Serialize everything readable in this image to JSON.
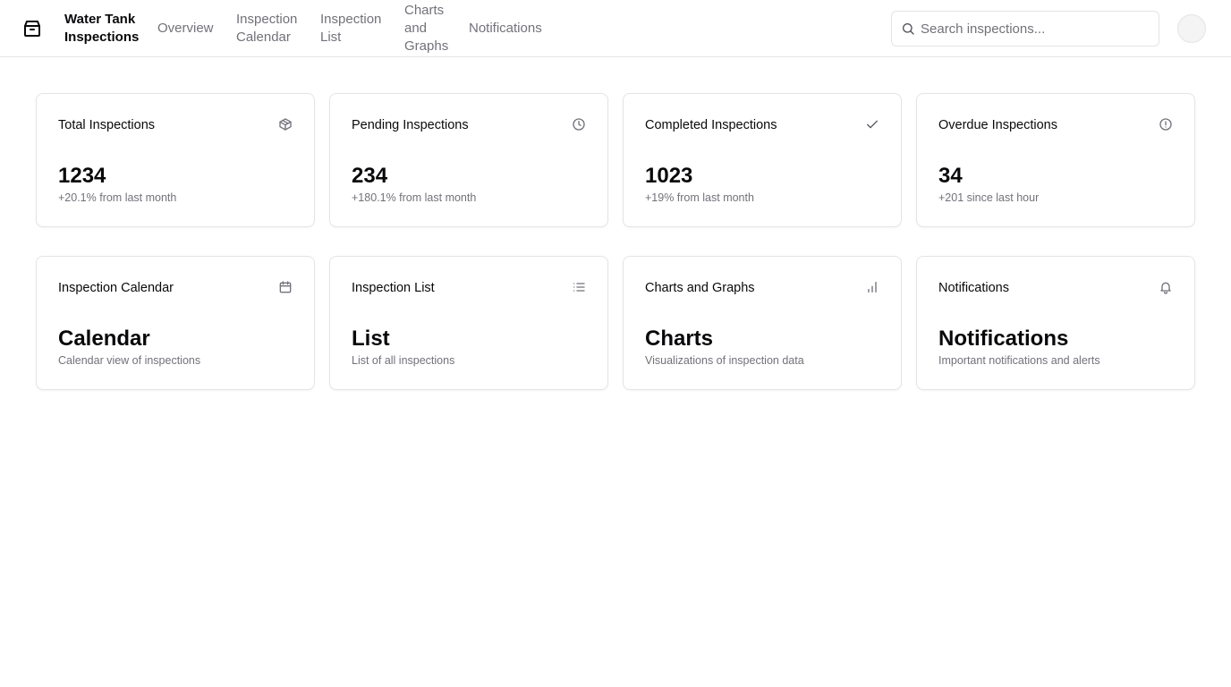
{
  "header": {
    "brand": "Water Tank Inspections",
    "logo_icon": "package-icon",
    "nav": [
      {
        "label": "Overview"
      },
      {
        "label": "Inspection Calendar"
      },
      {
        "label": "Inspection List"
      },
      {
        "label": "Charts and Graphs"
      },
      {
        "label": "Notifications"
      }
    ],
    "search": {
      "placeholder": "Search inspections...",
      "value": "",
      "icon": "search-icon"
    }
  },
  "stats": [
    {
      "title": "Total Inspections",
      "value": "1234",
      "sub": "+20.1% from last month",
      "icon": "box-icon"
    },
    {
      "title": "Pending Inspections",
      "value": "234",
      "sub": "+180.1% from last month",
      "icon": "clock-icon"
    },
    {
      "title": "Completed Inspections",
      "value": "1023",
      "sub": "+19% from last month",
      "icon": "check-icon"
    },
    {
      "title": "Overdue Inspections",
      "value": "34",
      "sub": "+201 since last hour",
      "icon": "alert-circle-icon"
    }
  ],
  "sections": [
    {
      "title": "Inspection Calendar",
      "value": "Calendar",
      "sub": "Calendar view of inspections",
      "icon": "calendar-icon"
    },
    {
      "title": "Inspection List",
      "value": "List",
      "sub": "List of all inspections",
      "icon": "list-icon"
    },
    {
      "title": "Charts and Graphs",
      "value": "Charts",
      "sub": "Visualizations of inspection data",
      "icon": "bar-chart-icon"
    },
    {
      "title": "Notifications",
      "value": "Notifications",
      "sub": "Important notifications and alerts",
      "icon": "bell-icon"
    }
  ],
  "colors": {
    "text": "#09090b",
    "muted": "#71717a",
    "border": "#e4e4e7"
  }
}
